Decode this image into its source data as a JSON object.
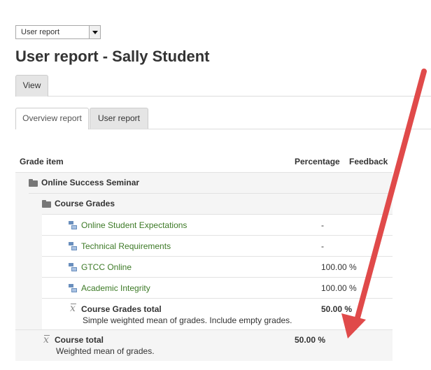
{
  "report_select": {
    "value": "User report"
  },
  "page_title": "User report - Sally Student",
  "tabs_primary": [
    {
      "label": "View"
    }
  ],
  "tabs_secondary": [
    {
      "label": "Overview report"
    },
    {
      "label": "User report"
    }
  ],
  "table": {
    "headers": {
      "grade_item": "Grade item",
      "percentage": "Percentage",
      "feedback": "Feedback"
    },
    "course": "Online Success Seminar",
    "category": "Course Grades",
    "items": [
      {
        "name": "Online Student Expectations",
        "percentage": "-"
      },
      {
        "name": "Technical Requirements",
        "percentage": "-"
      },
      {
        "name": "GTCC Online",
        "percentage": "100.00 %"
      },
      {
        "name": "Academic Integrity",
        "percentage": "100.00 %"
      }
    ],
    "category_total": {
      "label": "Course Grades total",
      "description": "Simple weighted mean of grades. Include empty grades.",
      "percentage": "50.00 %"
    },
    "course_total": {
      "label": "Course total",
      "description": "Weighted mean of grades.",
      "percentage": "50.00 %"
    }
  },
  "annotation": {
    "arrow_color": "#e04a4a"
  }
}
